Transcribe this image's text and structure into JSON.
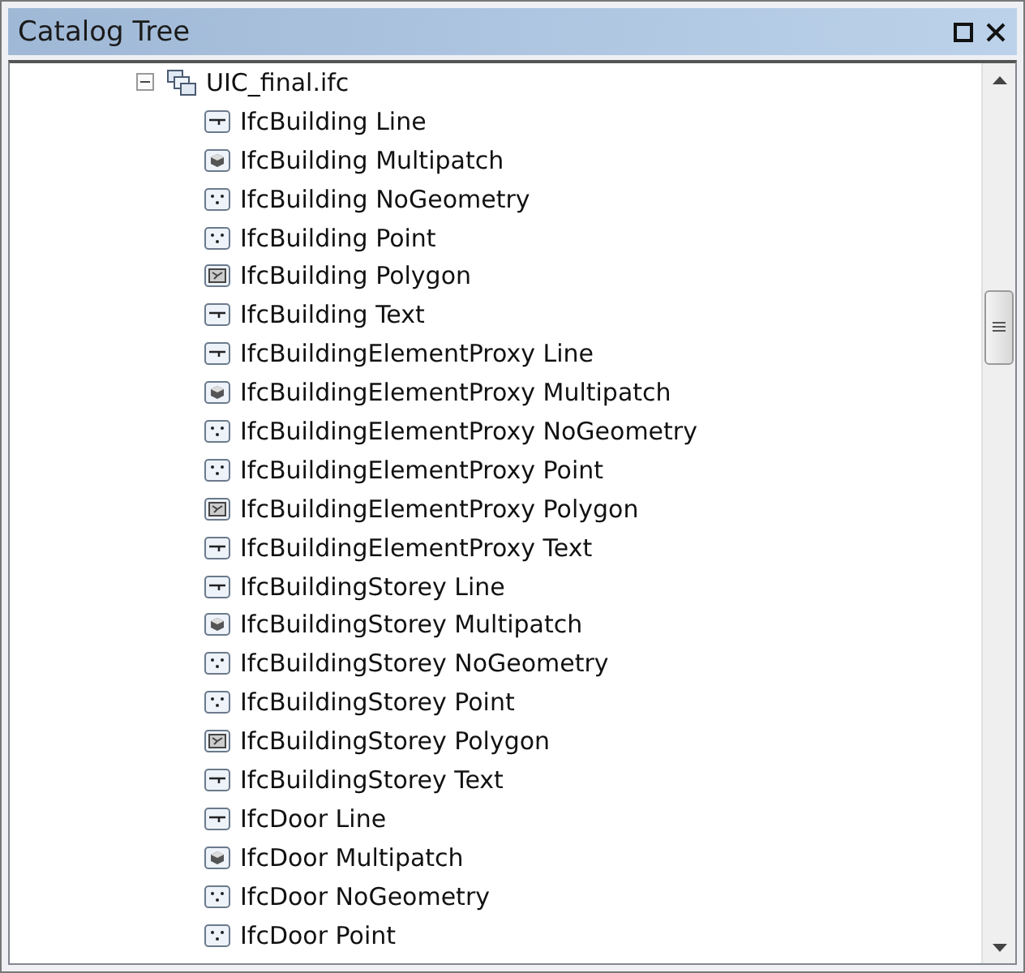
{
  "panel": {
    "title": "Catalog Tree"
  },
  "tree": [
    {
      "label": "UIC_final.ifc",
      "kind": "workspace",
      "expanded": true,
      "children": [
        {
          "label": "IfcBuilding Line",
          "kind": "line"
        },
        {
          "label": "IfcBuilding Multipatch",
          "kind": "multipatch"
        },
        {
          "label": "IfcBuilding NoGeometry",
          "kind": "point"
        },
        {
          "label": "IfcBuilding Point",
          "kind": "point"
        },
        {
          "label": "IfcBuilding Polygon",
          "kind": "polygon"
        },
        {
          "label": "IfcBuilding Text",
          "kind": "line"
        },
        {
          "label": "IfcBuildingElementProxy Line",
          "kind": "line"
        },
        {
          "label": "IfcBuildingElementProxy Multipatch",
          "kind": "multipatch"
        },
        {
          "label": "IfcBuildingElementProxy NoGeometry",
          "kind": "point"
        },
        {
          "label": "IfcBuildingElementProxy Point",
          "kind": "point"
        },
        {
          "label": "IfcBuildingElementProxy Polygon",
          "kind": "polygon"
        },
        {
          "label": "IfcBuildingElementProxy Text",
          "kind": "line"
        },
        {
          "label": "IfcBuildingStorey Line",
          "kind": "line"
        },
        {
          "label": "IfcBuildingStorey Multipatch",
          "kind": "multipatch"
        },
        {
          "label": "IfcBuildingStorey NoGeometry",
          "kind": "point"
        },
        {
          "label": "IfcBuildingStorey Point",
          "kind": "point"
        },
        {
          "label": "IfcBuildingStorey Polygon",
          "kind": "polygon"
        },
        {
          "label": "IfcBuildingStorey Text",
          "kind": "line"
        },
        {
          "label": "IfcDoor Line",
          "kind": "line"
        },
        {
          "label": "IfcDoor Multipatch",
          "kind": "multipatch"
        },
        {
          "label": "IfcDoor NoGeometry",
          "kind": "point"
        },
        {
          "label": "IfcDoor Point",
          "kind": "point"
        }
      ]
    }
  ]
}
